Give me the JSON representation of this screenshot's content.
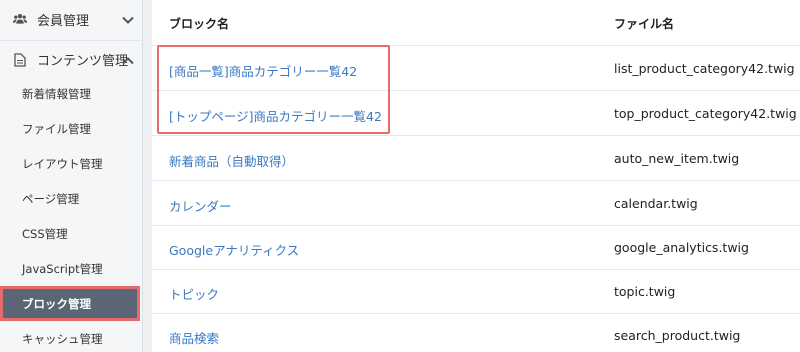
{
  "sidebar": {
    "members_label": "会員管理",
    "contents_label": "コンテンツ管理",
    "items": [
      {
        "label": "新着情報管理"
      },
      {
        "label": "ファイル管理"
      },
      {
        "label": "レイアウト管理"
      },
      {
        "label": "ページ管理"
      },
      {
        "label": "CSS管理"
      },
      {
        "label": "JavaScript管理"
      },
      {
        "label": "ブロック管理"
      },
      {
        "label": "キャッシュ管理"
      }
    ]
  },
  "table": {
    "col_block": "ブロック名",
    "col_file": "ファイル名",
    "rows": [
      {
        "name": "[商品一覧]商品カテゴリー一覧42",
        "file": "list_product_category42.twig"
      },
      {
        "name": "[トップページ]商品カテゴリー一覧42",
        "file": "top_product_category42.twig"
      },
      {
        "name": "新着商品（自動取得）",
        "file": "auto_new_item.twig"
      },
      {
        "name": "カレンダー",
        "file": "calendar.twig"
      },
      {
        "name": "Googleアナリティクス",
        "file": "google_analytics.twig"
      },
      {
        "name": "トピック",
        "file": "topic.twig"
      },
      {
        "name": "商品検索",
        "file": "search_product.twig"
      }
    ]
  },
  "colors": {
    "link": "#3a78c3",
    "active_bg": "#5a6673",
    "highlight": "#e56c6c"
  }
}
